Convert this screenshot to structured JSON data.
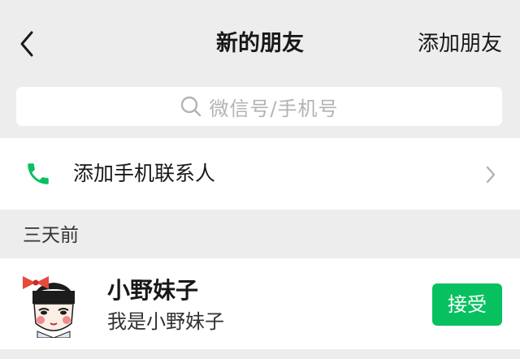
{
  "header": {
    "title": "新的朋友",
    "add_friends_label": "添加朋友",
    "back_icon": "chevron-left-icon"
  },
  "search": {
    "placeholder": "微信号/手机号",
    "icon": "search-icon"
  },
  "phone_contacts": {
    "label": "添加手机联系人",
    "icon": "phone-icon",
    "icon_color": "#07c160"
  },
  "section": {
    "label": "三天前"
  },
  "requests": [
    {
      "name": "小野妹子",
      "message": "我是小野妹子",
      "action_label": "接受",
      "action_color": "#07c160",
      "avatar": "cartoon-girl-avatar"
    }
  ]
}
